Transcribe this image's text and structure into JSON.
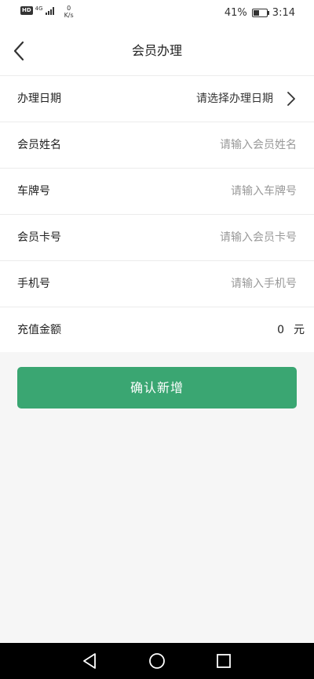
{
  "status_bar": {
    "hd": "HD",
    "network": "4G",
    "speed_value": "0",
    "speed_unit": "K/s",
    "battery_percent": "41%",
    "battery_level": 0.41,
    "time": "3:14"
  },
  "header": {
    "title": "会员办理"
  },
  "form": {
    "date": {
      "label": "办理日期",
      "value": "请选择办理日期"
    },
    "name": {
      "label": "会员姓名",
      "placeholder": "请输入会员姓名"
    },
    "plate": {
      "label": "车牌号",
      "placeholder": "请输入车牌号"
    },
    "card": {
      "label": "会员卡号",
      "placeholder": "请输入会员卡号"
    },
    "phone": {
      "label": "手机号",
      "placeholder": "请输入手机号"
    },
    "amount": {
      "label": "充值金额",
      "value": "0",
      "unit": "元"
    }
  },
  "actions": {
    "confirm_label": "确认新增"
  },
  "colors": {
    "accent": "#3aa672",
    "background": "#f6f6f6"
  }
}
